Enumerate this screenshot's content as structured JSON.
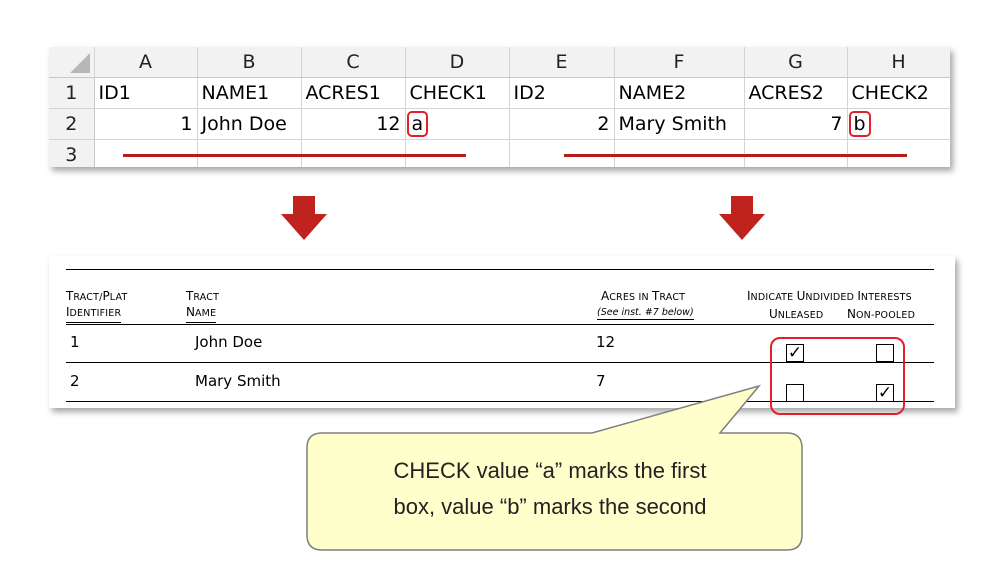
{
  "spreadsheet": {
    "column_headers": [
      "A",
      "B",
      "C",
      "D",
      "E",
      "F",
      "G",
      "H"
    ],
    "row_headers": [
      "1",
      "2",
      "3"
    ],
    "row1": [
      "ID1",
      "NAME1",
      "ACRES1",
      "CHECK1",
      "ID2",
      "NAME2",
      "ACRES2",
      "CHECK2"
    ],
    "row2": {
      "id1": "1",
      "name1": "John Doe",
      "acres1": "12",
      "check1": "a",
      "id2": "2",
      "name2": "Mary Smith",
      "acres2": "7",
      "check2": "b"
    }
  },
  "form": {
    "col1": {
      "line1_cap": "T",
      "line1_rest": "RACT/",
      "line1_cap2": "P",
      "line1_rest2": "LAT",
      "line2_cap": "I",
      "line2_rest": "DENTIFIER"
    },
    "col2": {
      "line1_cap": "T",
      "line1_rest": "RACT",
      "line2_cap": "N",
      "line2_rest": "AME"
    },
    "col3": {
      "cap1": "A",
      "rest1": "CRES IN ",
      "cap2": "T",
      "rest2": "RACT",
      "instruction": "(See inst. #7 below)"
    },
    "col4": {
      "title_parts": [
        "I",
        "NDICATE ",
        "U",
        "NDIVIDED ",
        "I",
        "NTERESTS"
      ],
      "sub1_cap": "U",
      "sub1_rest": "NLEASED",
      "sub2_cap": "N",
      "sub2_rest": "ON-POOLED"
    },
    "rows": [
      {
        "id": "1",
        "name": "John Doe",
        "acres": "12",
        "unleased": "✓",
        "nonpooled": ""
      },
      {
        "id": "2",
        "name": "Mary Smith",
        "acres": "7",
        "unleased": "",
        "nonpooled": "✓"
      }
    ]
  },
  "callout": {
    "line1": "CHECK value “a” marks the first",
    "line2": "box, value “b” marks the second"
  },
  "colors": {
    "highlight_red": "#e0202a",
    "underline_red": "#b71c1c",
    "arrow_red": "#c0231e",
    "callout_fill": "#ffffcc"
  }
}
